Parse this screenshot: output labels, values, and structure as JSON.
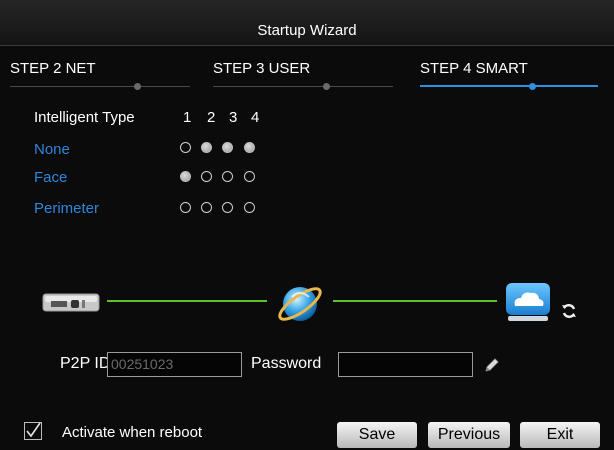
{
  "window": {
    "title": "Startup Wizard"
  },
  "steps": [
    {
      "label": "STEP 2 NET"
    },
    {
      "label": "STEP 3 USER"
    },
    {
      "label": "STEP 4 SMART"
    }
  ],
  "smart": {
    "header_label": "Intelligent Type",
    "columns": [
      "1",
      "2",
      "3",
      "4"
    ],
    "rows": [
      {
        "label": "None",
        "selected": [
          false,
          true,
          true,
          true
        ]
      },
      {
        "label": "Face",
        "selected": [
          true,
          false,
          false,
          false
        ]
      },
      {
        "label": "Perimeter",
        "selected": [
          false,
          false,
          false,
          false
        ]
      }
    ]
  },
  "network": {
    "device_icon": "dvr-recorder-icon",
    "internet_icon": "globe-icon",
    "cloud_icon": "cloud-icon",
    "refresh_icon": "refresh-icon",
    "line_color": "#5fbf2a"
  },
  "p2p": {
    "id_label": "P2P ID",
    "id_value": "00251023",
    "password_label": "Password",
    "password_value": "",
    "edit_icon": "pencil-icon"
  },
  "footer": {
    "activate_label": "Activate when reboot",
    "activate_checked": true,
    "save_label": "Save",
    "previous_label": "Previous",
    "exit_label": "Exit"
  },
  "colors": {
    "accent": "#2f8fe0",
    "link": "#2e86dc",
    "background": "#0b0b0b"
  }
}
